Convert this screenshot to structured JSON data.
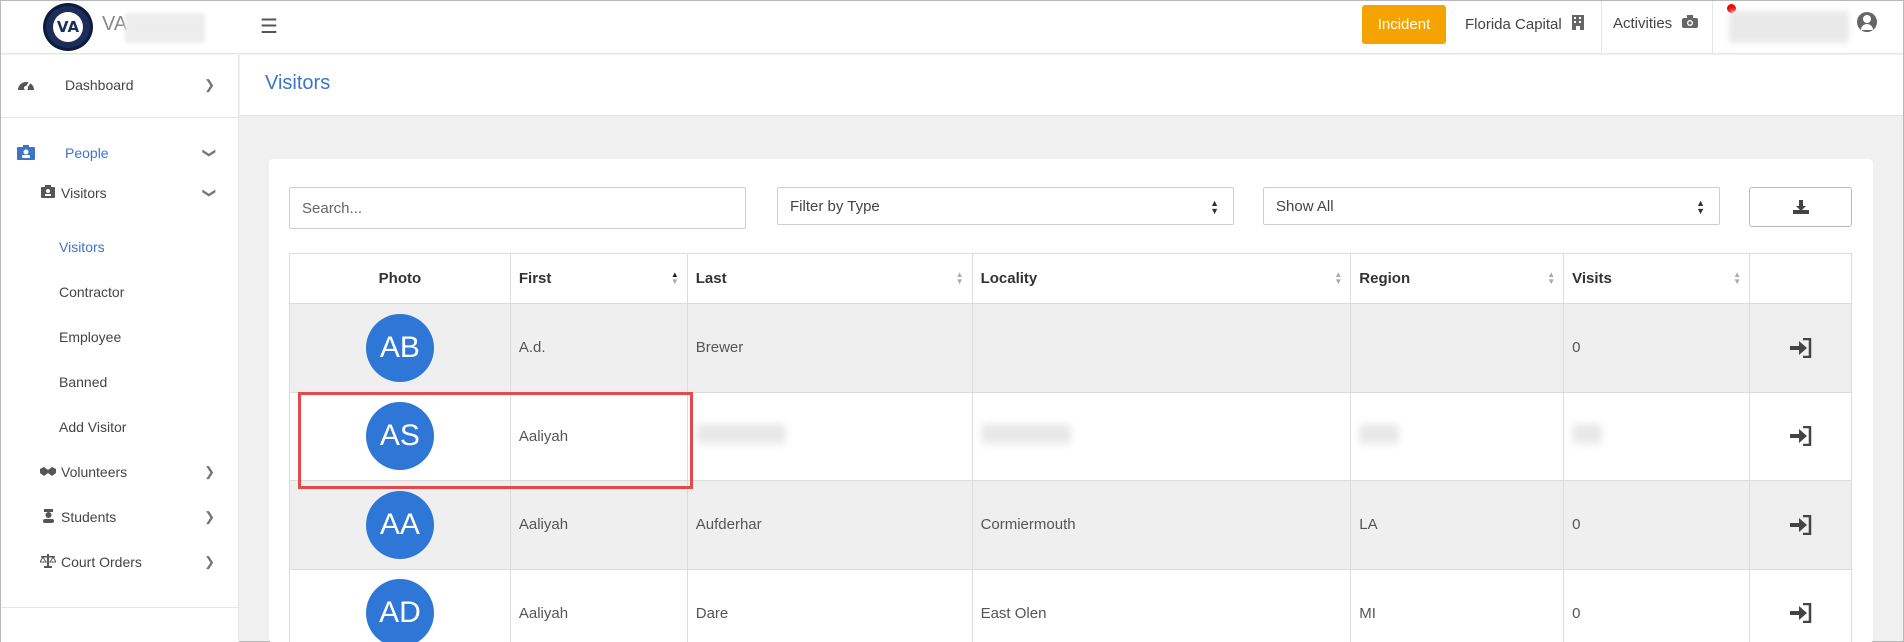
{
  "header": {
    "brand": "VA",
    "incident_label": "Incident",
    "location_label": "Florida Capital",
    "activities_label": "Activities"
  },
  "sidebar": {
    "dashboard": "Dashboard",
    "people": "People",
    "visitors_group": "Visitors",
    "visitors_sub": [
      "Visitors",
      "Contractor",
      "Employee",
      "Banned",
      "Add Visitor"
    ],
    "volunteers": "Volunteers",
    "students": "Students",
    "court_orders": "Court Orders"
  },
  "page": {
    "title": "Visitors"
  },
  "filters": {
    "search_placeholder": "Search...",
    "type_selected": "Filter by Type",
    "show_selected": "Show All"
  },
  "table": {
    "columns": [
      "Photo",
      "First",
      "Last",
      "Locality",
      "Region",
      "Visits"
    ],
    "rows": [
      {
        "initials": "AB",
        "first": "A.d.",
        "last": "Brewer",
        "locality": "",
        "region": "",
        "visits": "0"
      },
      {
        "initials": "AS",
        "first": "Aaliyah",
        "last": "",
        "locality": "",
        "region": "",
        "visits": ""
      },
      {
        "initials": "AA",
        "first": "Aaliyah",
        "last": "Aufderhar",
        "locality": "Cormiermouth",
        "region": "LA",
        "visits": "0"
      },
      {
        "initials": "AD",
        "first": "Aaliyah",
        "last": "Dare",
        "locality": "East Olen",
        "region": "MI",
        "visits": "0"
      }
    ]
  },
  "colors": {
    "accent": "#3d74c8",
    "incident": "#f5a300",
    "avatar": "#2f77d6",
    "highlight": "#e34a4a"
  }
}
